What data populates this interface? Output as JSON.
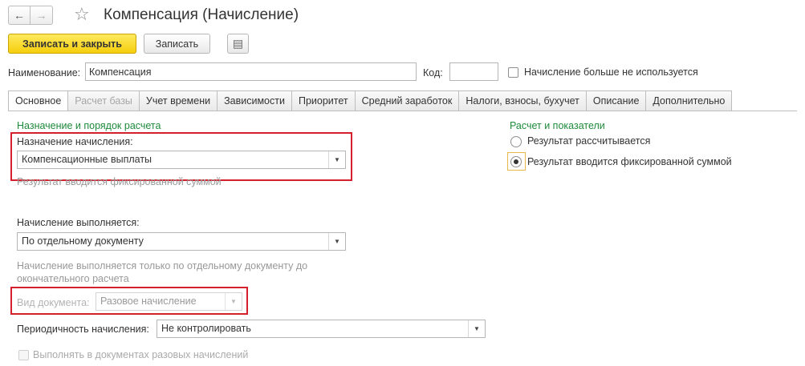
{
  "window": {
    "title": "Компенсация (Начисление)"
  },
  "nav": {
    "back_icon": "←",
    "forward_icon": "→",
    "favorite_icon": "☆"
  },
  "toolbar": {
    "save_close_label": "Записать и закрыть",
    "save_label": "Записать",
    "more_icon": "▤"
  },
  "header_fields": {
    "name_label": "Наименование:",
    "name_value": "Компенсация",
    "code_label": "Код:",
    "code_value": "",
    "not_used_label": "Начисление больше не используется",
    "not_used_checked": false
  },
  "tabs": [
    {
      "label": "Основное",
      "active": true
    },
    {
      "label": "Расчет базы",
      "disabled": true
    },
    {
      "label": "Учет времени"
    },
    {
      "label": "Зависимости"
    },
    {
      "label": "Приоритет"
    },
    {
      "label": "Средний заработок"
    },
    {
      "label": "Налоги, взносы, бухучет"
    },
    {
      "label": "Описание"
    },
    {
      "label": "Дополнительно"
    }
  ],
  "main": {
    "purpose_group_title": "Назначение и порядок расчета",
    "purpose_label": "Назначение начисления:",
    "purpose_value": "Компенсационные выплаты",
    "purpose_hint": "Результат вводится фиксированной суммой",
    "execution_label": "Начисление выполняется:",
    "execution_value": "По отдельному документу",
    "execution_hint_line1": "Начисление выполняется только по отдельному документу до",
    "execution_hint_line2": "окончательного расчета",
    "doc_type_label": "Вид документа:",
    "doc_type_value": "Разовое начисление",
    "periodicity_label": "Периодичность начисления:",
    "periodicity_value": "Не контролировать",
    "one_time_docs_label": "Выполнять в документах разовых начислений",
    "dropdown_arrow": "▼"
  },
  "calc": {
    "group_title": "Расчет и показатели",
    "options": [
      {
        "label": "Результат рассчитывается",
        "selected": false
      },
      {
        "label": "Результат вводится фиксированной суммой",
        "selected": true
      }
    ]
  },
  "colors": {
    "accent_yellow": "#f5ce0c",
    "group_title_green": "#1e8a3b",
    "highlight_red": "#d4202a"
  }
}
